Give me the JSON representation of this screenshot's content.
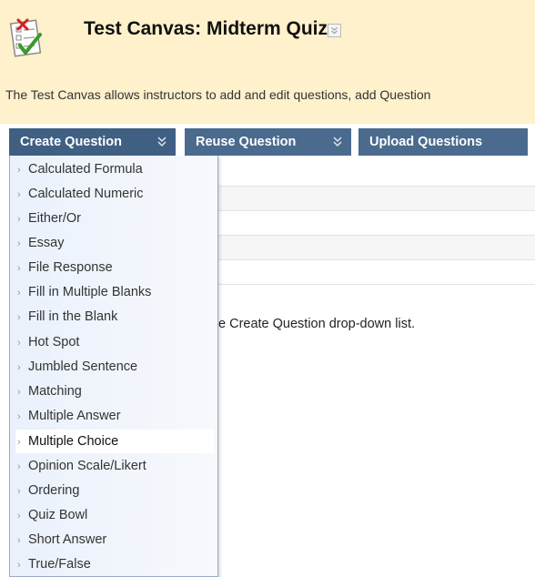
{
  "header": {
    "title": "Test Canvas: Midterm Quiz",
    "description": "The Test Canvas allows instructors to add and edit questions, add Question"
  },
  "action_bar": {
    "create_label": "Create Question",
    "reuse_label": "Reuse Question",
    "upload_label": "Upload Questions"
  },
  "instruction_fragment": "e Create Question drop-down list.",
  "question_types": [
    "Calculated Formula",
    "Calculated Numeric",
    "Either/Or",
    "Essay",
    "File Response",
    "Fill in Multiple Blanks",
    "Fill in the Blank",
    "Hot Spot",
    "Jumbled Sentence",
    "Matching",
    "Multiple Answer",
    "Multiple Choice",
    "Opinion Scale/Likert",
    "Ordering",
    "Quiz Bowl",
    "Short Answer",
    "True/False"
  ],
  "selected_question_type": "Multiple Choice",
  "colors": {
    "header_bg": "#fef1cc",
    "button_bg": "#4a6a8e",
    "menu_bg": "#eaf1fb"
  }
}
